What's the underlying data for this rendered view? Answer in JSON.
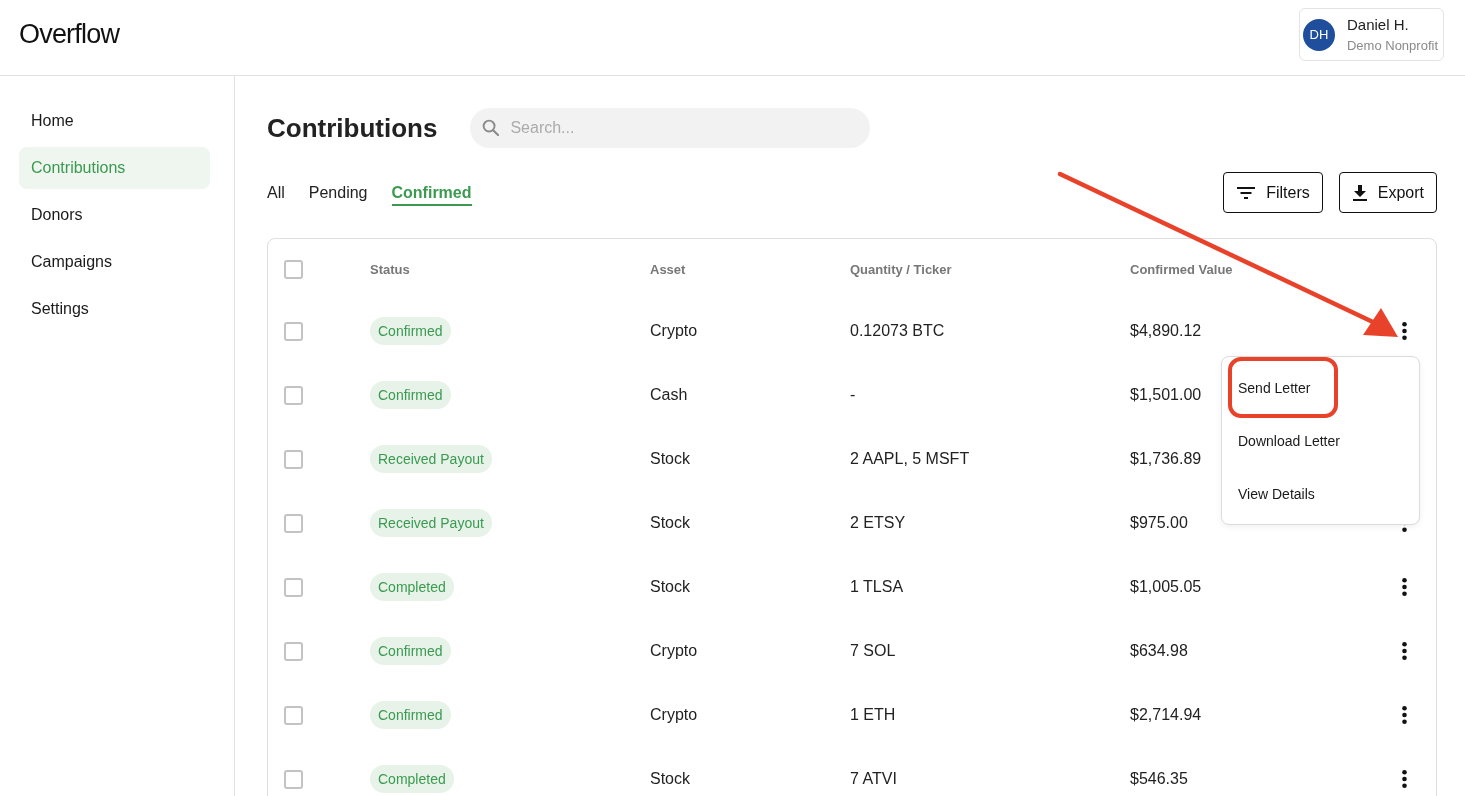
{
  "header": {
    "logo": "Overflow",
    "user": {
      "initials": "DH",
      "name": "Daniel H.",
      "organization": "Demo Nonprofit"
    }
  },
  "sidebar": {
    "items": [
      {
        "label": "Home",
        "selected": false
      },
      {
        "label": "Contributions",
        "selected": true
      },
      {
        "label": "Donors",
        "selected": false
      },
      {
        "label": "Campaigns",
        "selected": false
      },
      {
        "label": "Settings",
        "selected": false
      }
    ]
  },
  "main": {
    "title": "Contributions",
    "search": {
      "placeholder": "Search..."
    },
    "tabs": [
      {
        "label": "All",
        "selected": false
      },
      {
        "label": "Pending",
        "selected": false
      },
      {
        "label": "Confirmed",
        "selected": true
      }
    ],
    "buttons": [
      {
        "label": "Filters",
        "kind": "filter"
      },
      {
        "label": "Export",
        "kind": "export"
      }
    ]
  },
  "table": {
    "select_all_checked": false,
    "columns": [
      "Status",
      "Asset",
      "Quantity / Ticker",
      "Confirmed Value"
    ],
    "rows": [
      {
        "checked": false,
        "status": "Confirmed",
        "asset": "Crypto",
        "quantity": "0.12073 BTC",
        "value": "$4,890.12",
        "menu_open": true,
        "arrow_marked": true
      },
      {
        "checked": false,
        "status": "Confirmed",
        "asset": "Cash",
        "quantity": "-",
        "value": "$1,501.00",
        "menu_open": false,
        "arrow_marked": false
      },
      {
        "checked": false,
        "status": "Received Payout",
        "asset": "Stock",
        "quantity": "2 AAPL, 5 MSFT",
        "value": "$1,736.89",
        "menu_open": false,
        "arrow_marked": false
      },
      {
        "checked": false,
        "status": "Received Payout",
        "asset": "Stock",
        "quantity": "2 ETSY",
        "value": "$975.00",
        "menu_open": false,
        "arrow_marked": false
      },
      {
        "checked": false,
        "status": "Completed",
        "asset": "Stock",
        "quantity": "1 TLSA",
        "value": "$1,005.05",
        "menu_open": false,
        "arrow_marked": false
      },
      {
        "checked": false,
        "status": "Confirmed",
        "asset": "Crypto",
        "quantity": "7 SOL",
        "value": "$634.98",
        "menu_open": false,
        "arrow_marked": false
      },
      {
        "checked": false,
        "status": "Confirmed",
        "asset": "Crypto",
        "quantity": "1 ETH",
        "value": "$2,714.94",
        "menu_open": false,
        "arrow_marked": false
      },
      {
        "checked": false,
        "status": "Completed",
        "asset": "Stock",
        "quantity": "7 ATVI",
        "value": "$546.35",
        "menu_open": false,
        "arrow_marked": false
      }
    ],
    "menu": {
      "items": [
        {
          "label": "Send Letter",
          "highlighted": true
        },
        {
          "label": "Download Letter",
          "highlighted": false
        },
        {
          "label": "View Details",
          "highlighted": false
        }
      ]
    }
  }
}
